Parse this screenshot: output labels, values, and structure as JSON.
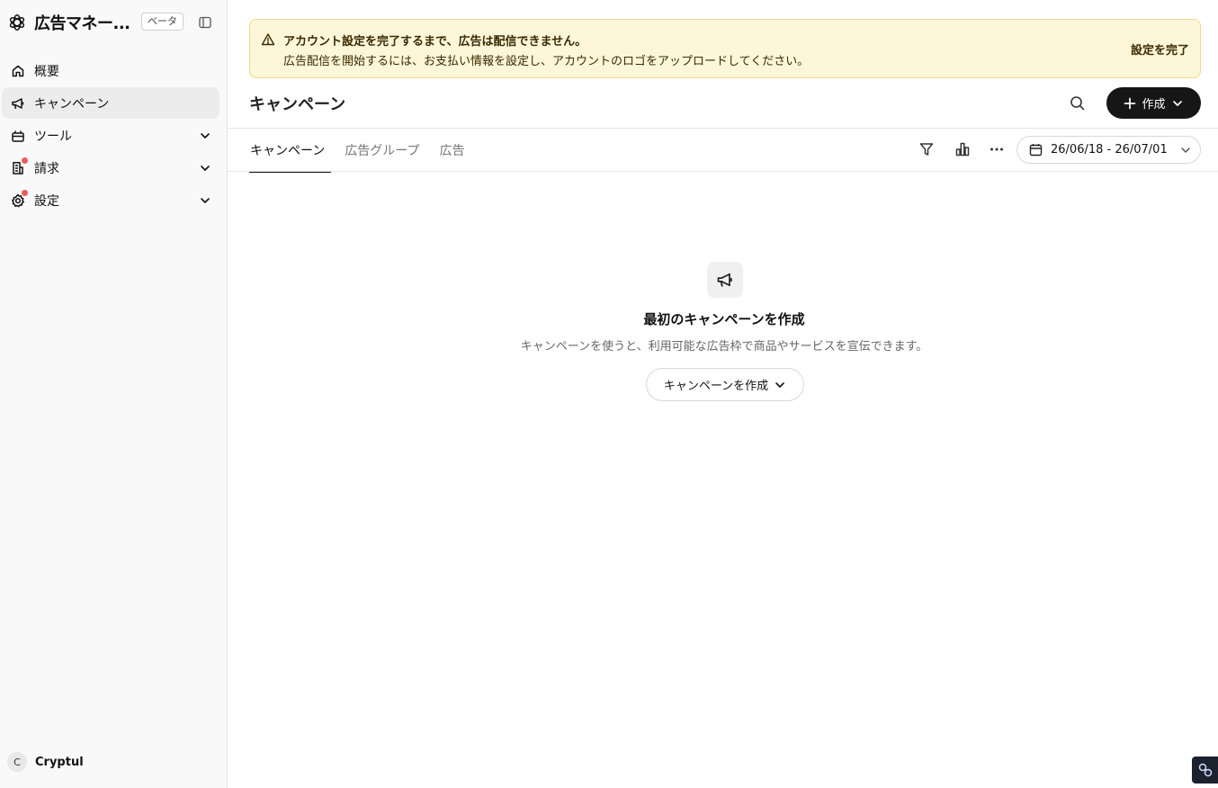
{
  "sidebar": {
    "brand_title": "広告マネー...",
    "beta_label": "ベータ",
    "items": [
      {
        "label": "概要",
        "icon": "home-icon"
      },
      {
        "label": "キャンペーン",
        "icon": "megaphone-icon",
        "active": true
      },
      {
        "label": "ツール",
        "icon": "tools-icon",
        "expandable": true
      },
      {
        "label": "請求",
        "icon": "billing-icon",
        "expandable": true,
        "notification": true
      },
      {
        "label": "設定",
        "icon": "settings-gear-icon",
        "expandable": true,
        "notification": true
      }
    ],
    "user": {
      "initial": "C",
      "name": "Cryptul"
    }
  },
  "alert": {
    "title": "アカウント設定を完了するまで、広告は配信できません。",
    "text": "広告配信を開始するには、お支払い情報を設定し、アカウントのロゴをアップロードしてください。",
    "action": "設定を完了",
    "icon": "warning-triangle-icon"
  },
  "header": {
    "title": "キャンペーン",
    "create_label": "作成"
  },
  "tabs": [
    {
      "label": "キャンペーン",
      "active": true
    },
    {
      "label": "広告グループ"
    },
    {
      "label": "広告"
    }
  ],
  "toolbar": {
    "date_range": "26/06/18 - 26/07/01"
  },
  "empty_state": {
    "title": "最初のキャンペーンを作成",
    "description": "キャンペーンを使うと、利用可能な広告枠で商品やサービスを宣伝できます。",
    "button_label": "キャンペーンを作成"
  },
  "colors": {
    "alert_background": "#fef6d9",
    "alert_border": "#f2d98a",
    "primary_button": "#161616",
    "notification_dot": "#ef5b5b"
  }
}
